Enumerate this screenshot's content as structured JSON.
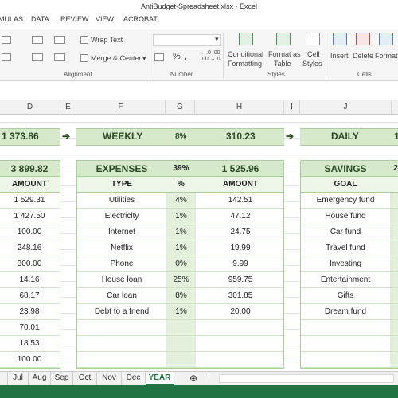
{
  "window": {
    "title": "AntiBudget-Spreadsheet.xlsx - Excel"
  },
  "ribbon_tabs": [
    "MULAS",
    "DATA",
    "REVIEW",
    "VIEW",
    "ACROBAT"
  ],
  "ribbon": {
    "wrap_text": "Wrap Text",
    "merge_center": "Merge & Center",
    "alignment_group": "Alignment",
    "number_group": "Number",
    "styles_group": "Styles",
    "cells_group": "Cells",
    "percent_symbol": "%",
    "comma_symbol": ",",
    "inc_decimal": "←.0 .00",
    "dec_decimal": ".00 →.0",
    "conditional_formatting_1": "Conditional",
    "conditional_formatting_2": "Formatting",
    "format_as_table_1": "Format as",
    "format_as_table_2": "Table",
    "cell_styles_1": "Cell",
    "cell_styles_2": "Styles",
    "insert": "Insert",
    "delete": "Delete",
    "format": "Format"
  },
  "columns": [
    "D",
    "E",
    "F",
    "G",
    "H",
    "I",
    "J"
  ],
  "summary_band": {
    "left_amount": "1 373.86",
    "weekly_label": "WEEKLY",
    "weekly_pct": "8%",
    "weekly_amount": "310.23",
    "daily_label": "DAILY",
    "daily_partial": "1"
  },
  "left_table": {
    "total": "3 899.82",
    "header": "AMOUNT",
    "values": [
      "1 529.31",
      "1 427.50",
      "100.00",
      "248.16",
      "300.00",
      "14.16",
      "68.17",
      "23.98",
      "70.01",
      "18.53",
      "100.00"
    ]
  },
  "expenses": {
    "title": "EXPENSES",
    "pct": "39%",
    "total": "1 525.96",
    "headers": {
      "type": "TYPE",
      "pct": "%",
      "amount": "AMOUNT"
    },
    "rows": [
      {
        "type": "Utilities",
        "pct": "4%",
        "amount": "142.51"
      },
      {
        "type": "Electricity",
        "pct": "1%",
        "amount": "47.12"
      },
      {
        "type": "Internet",
        "pct": "1%",
        "amount": "24.75"
      },
      {
        "type": "Netflix",
        "pct": "1%",
        "amount": "19.99"
      },
      {
        "type": "Phone",
        "pct": "0%",
        "amount": "9.99"
      },
      {
        "type": "House loan",
        "pct": "25%",
        "amount": "959.75"
      },
      {
        "type": "Car loan",
        "pct": "8%",
        "amount": "301.85"
      },
      {
        "type": "Debt to a friend",
        "pct": "1%",
        "amount": "20.00"
      }
    ]
  },
  "savings": {
    "title": "SAVINGS",
    "partial": "2",
    "header": "GOAL",
    "goals": [
      "Emergency fund",
      "House fund",
      "Car fund",
      "Travel fund",
      "Investing",
      "Entertainment",
      "Gifts",
      "Dream fund"
    ]
  },
  "sheet_tabs": [
    "Jul",
    "Aug",
    "Sep",
    "Oct",
    "Nov",
    "Dec",
    "YEAR"
  ],
  "active_sheet": "YEAR",
  "add_sheet": "⊕",
  "arrow_glyph": "➔"
}
